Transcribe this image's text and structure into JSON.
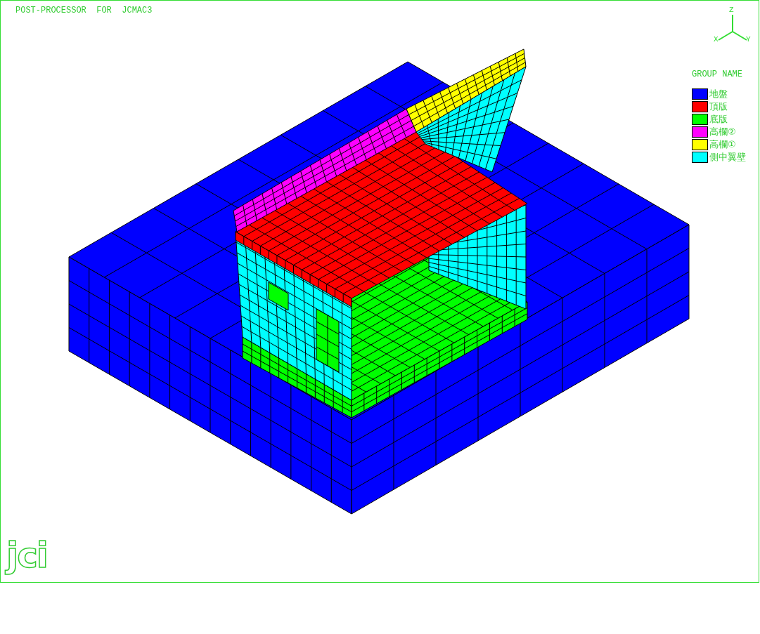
{
  "window": {
    "title": "POST-PROCESSOR  FOR  JCMAC3"
  },
  "axes": {
    "z": "Z",
    "x": "X",
    "y": "Y"
  },
  "legend": {
    "title": "GROUP NAME",
    "groups": [
      {
        "name": "地盤",
        "color": "#0000ff"
      },
      {
        "name": "頂版",
        "color": "#ff0000"
      },
      {
        "name": "底版",
        "color": "#00ff00"
      },
      {
        "name": "高欄②",
        "color": "#ff00ff"
      },
      {
        "name": "高欄①",
        "color": "#ffff00"
      },
      {
        "name": "側中翼壁",
        "color": "#00ffff"
      }
    ]
  },
  "logo": "jci"
}
